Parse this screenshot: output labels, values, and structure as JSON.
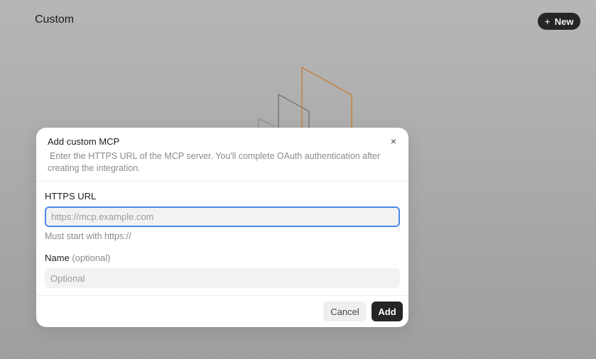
{
  "page": {
    "title": "Custom",
    "new_button_icon": "+",
    "new_button_label": "New"
  },
  "modal": {
    "title": "Add custom MCP",
    "description": "Enter the HTTPS URL of the MCP server. You'll complete OAuth authentication after creating the integration.",
    "close_icon": "×",
    "url_field": {
      "label": "HTTPS URL",
      "value": "",
      "placeholder": "https://mcp.example.com",
      "hint": "Must start with https://"
    },
    "name_field": {
      "label": "Name",
      "label_suffix": "(optional)",
      "value": "",
      "placeholder": "Optional"
    },
    "cancel_label": "Cancel",
    "add_label": "Add"
  },
  "colors": {
    "accent_focus": "#4a8ae6",
    "dark_button": "#252525",
    "illustration_accent": "#c77722",
    "illustration_gray": "#6d6d6d"
  },
  "icons": [
    "plus-icon",
    "close-icon"
  ]
}
